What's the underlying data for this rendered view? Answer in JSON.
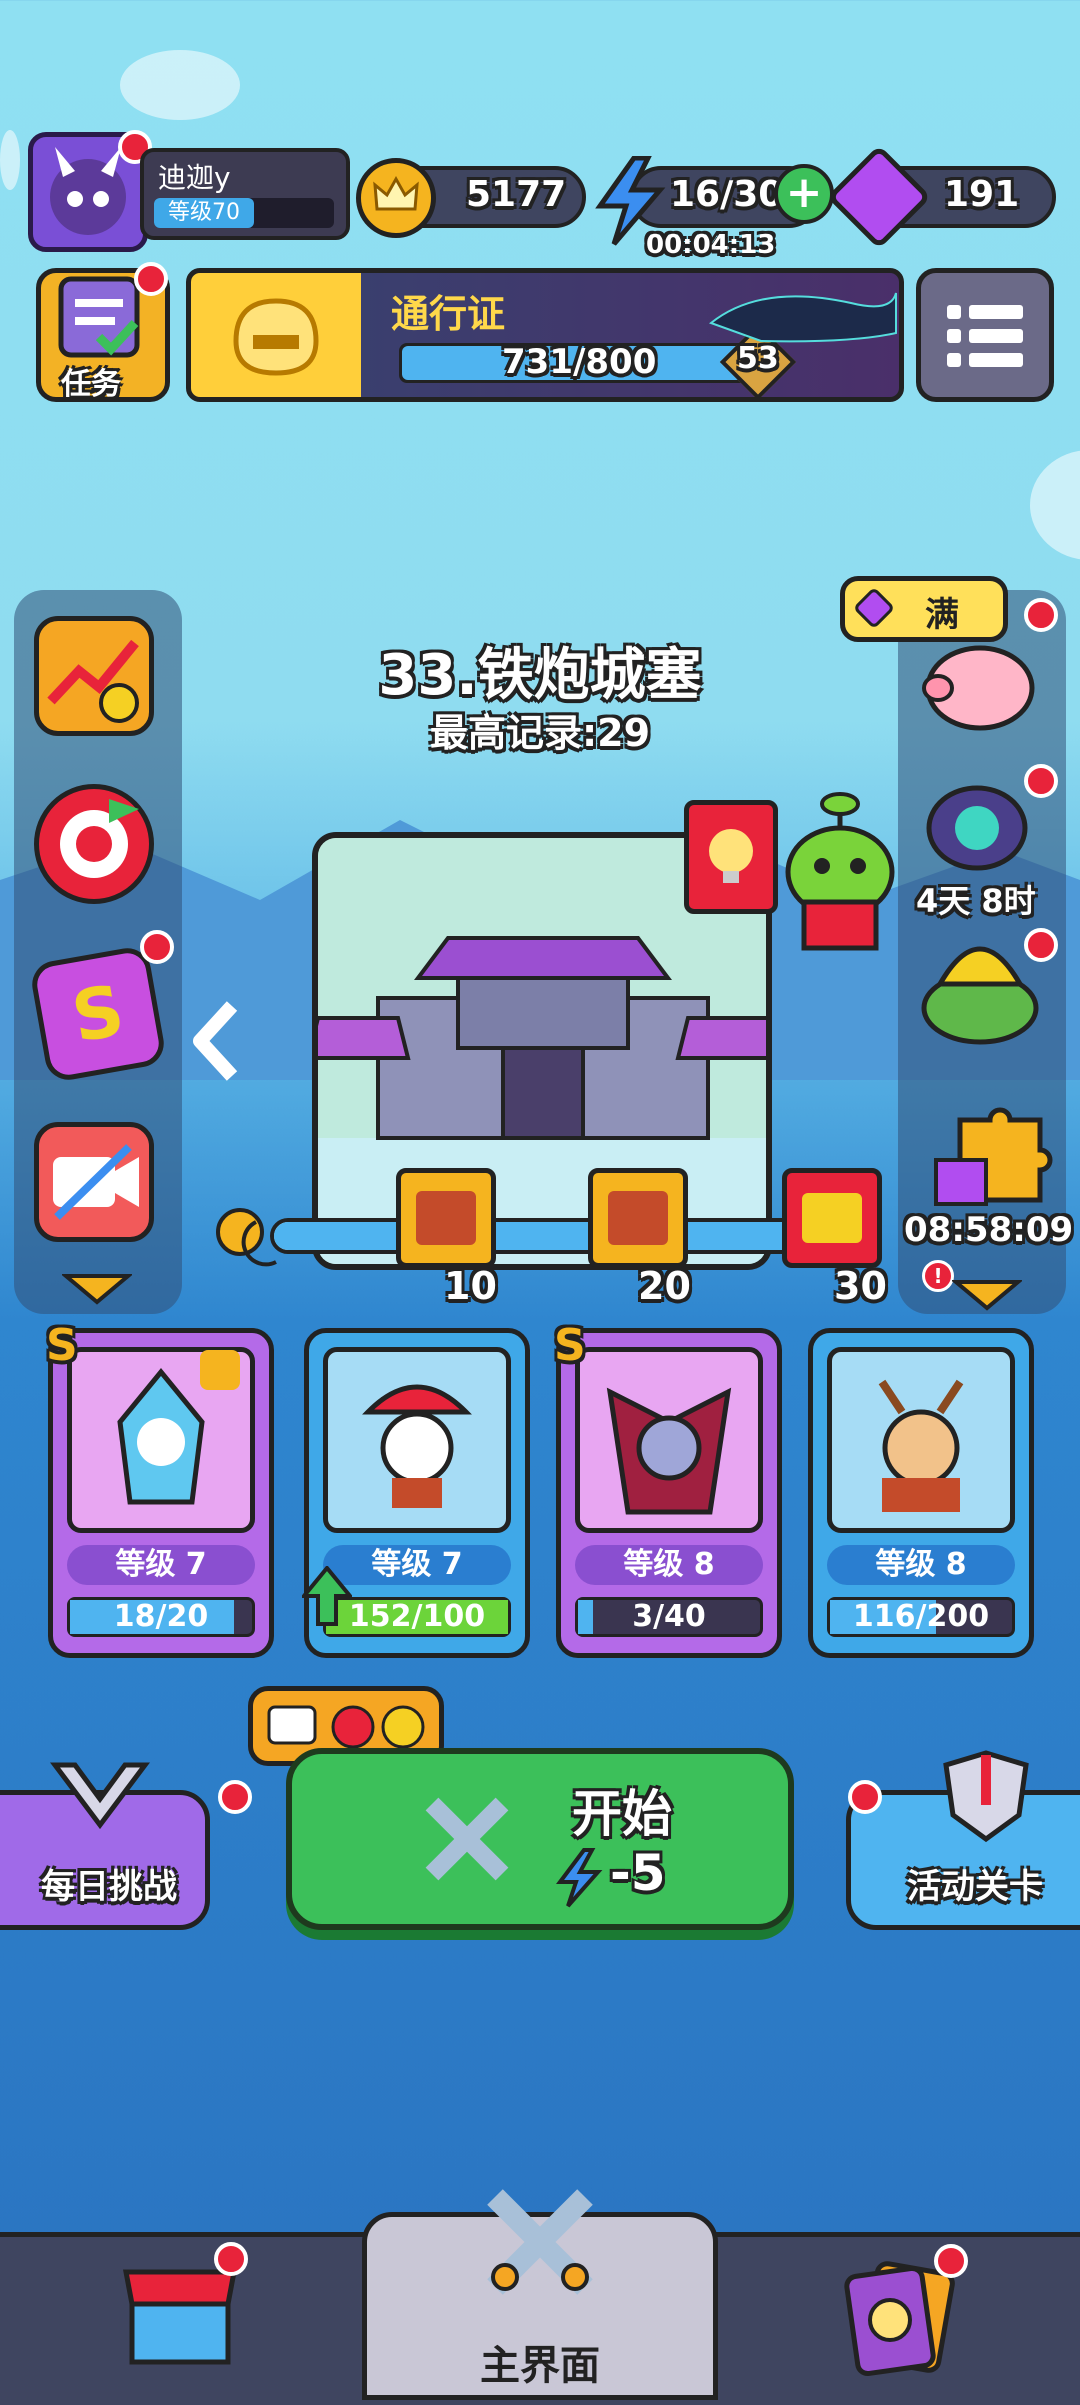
{
  "player": {
    "name": "迪迦y",
    "level_label": "等级70"
  },
  "resources": {
    "gold": "5177",
    "energy": "16/30",
    "energy_timer": "00:04:13",
    "gems": "191"
  },
  "tasks_label": "任务",
  "pass": {
    "title": "通行证",
    "progress": "731/800",
    "progress_fraction": 0.914,
    "level": "53"
  },
  "stage": {
    "title": "33.铁炮城塞",
    "best_record": "最高记录:29"
  },
  "piggy_label": "满",
  "side_right": {
    "event_timer": "4天 8时",
    "puzzle_timer": "08:58:09"
  },
  "milestones": [
    "10",
    "20",
    "30"
  ],
  "heroes": [
    {
      "rank": "S",
      "level": "等级 7",
      "progress": "18/20",
      "fraction": 0.9,
      "color": "#b46ae8"
    },
    {
      "rank": "",
      "level": "等级 7",
      "progress": "152/100",
      "fraction": 1.0,
      "color": "#3fa8e8"
    },
    {
      "rank": "S",
      "level": "等级 8",
      "progress": "3/40",
      "fraction": 0.075,
      "color": "#b46ae8"
    },
    {
      "rank": "",
      "level": "等级 8",
      "progress": "116/200",
      "fraction": 0.58,
      "color": "#3fa8e8"
    }
  ],
  "buttons": {
    "daily": "每日挑战",
    "start": "开始",
    "start_cost": "-5",
    "event": "活动关卡"
  },
  "nav": {
    "main": "主界面"
  }
}
